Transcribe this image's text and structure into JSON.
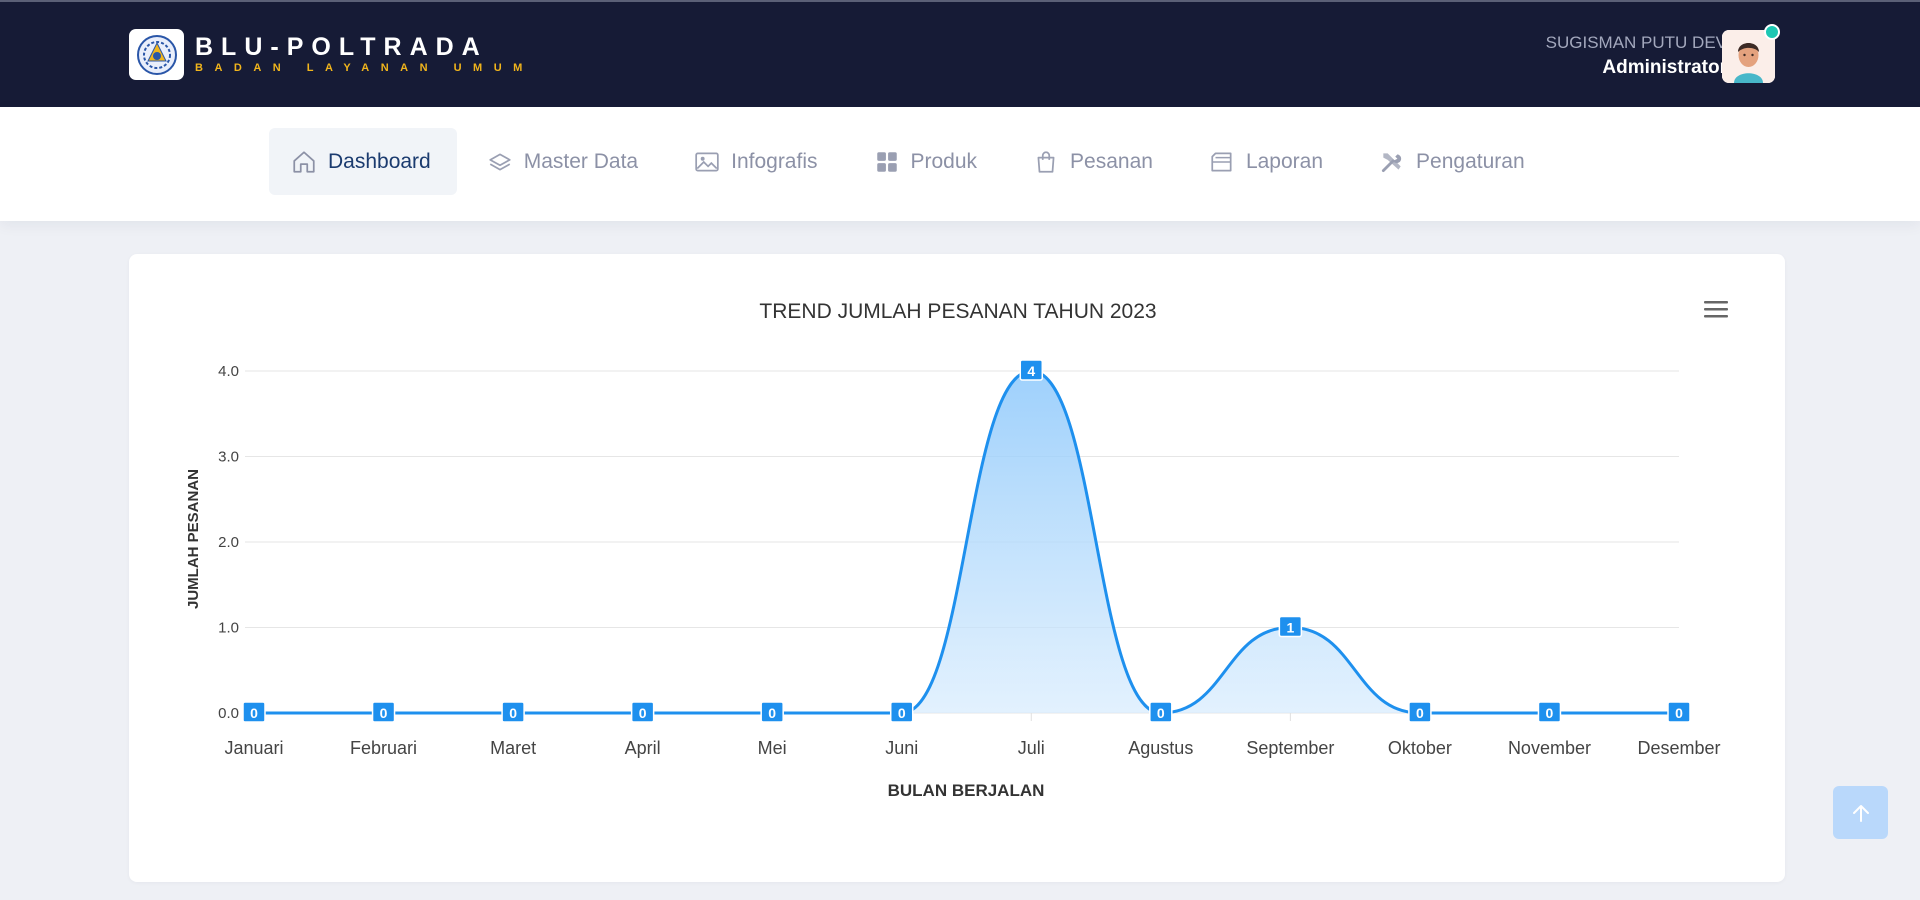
{
  "header": {
    "brand_title": "BLU-POLTRADA",
    "brand_subtitle": "BADAN LAYANAN UMUM",
    "user_name": "SUGISMAN PUTU DEV",
    "user_role": "Administrator"
  },
  "nav": {
    "items": [
      {
        "label": "Dashboard",
        "icon": "home-icon",
        "active": true
      },
      {
        "label": "Master Data",
        "icon": "layers-icon"
      },
      {
        "label": "Infografis",
        "icon": "image-icon"
      },
      {
        "label": "Produk",
        "icon": "grid-icon"
      },
      {
        "label": "Pesanan",
        "icon": "shopping-bag-icon"
      },
      {
        "label": "Laporan",
        "icon": "folder-icon"
      },
      {
        "label": "Pengaturan",
        "icon": "tools-icon"
      }
    ]
  },
  "colors": {
    "header_bg": "#161b36",
    "accent": "#f1b51c",
    "series": "#1e90ee",
    "nav_active_text": "#1b3b6f"
  },
  "chart_data": {
    "type": "area",
    "title": "TREND JUMLAH PESANAN TAHUN 2023",
    "xlabel": "BULAN BERJALAN",
    "ylabel": "JUMLAH PESANAN",
    "categories": [
      "Januari",
      "Februari",
      "Maret",
      "April",
      "Mei",
      "Juni",
      "Juli",
      "Agustus",
      "September",
      "Oktober",
      "November",
      "Desember"
    ],
    "values": [
      0,
      0,
      0,
      0,
      0,
      0,
      4,
      0,
      1,
      0,
      0,
      0
    ],
    "yticks": [
      "0.0",
      "1.0",
      "2.0",
      "3.0",
      "4.0"
    ],
    "ylim": [
      0,
      4
    ],
    "grid": true,
    "legend": "none",
    "smooth": true,
    "data_labels": true
  }
}
